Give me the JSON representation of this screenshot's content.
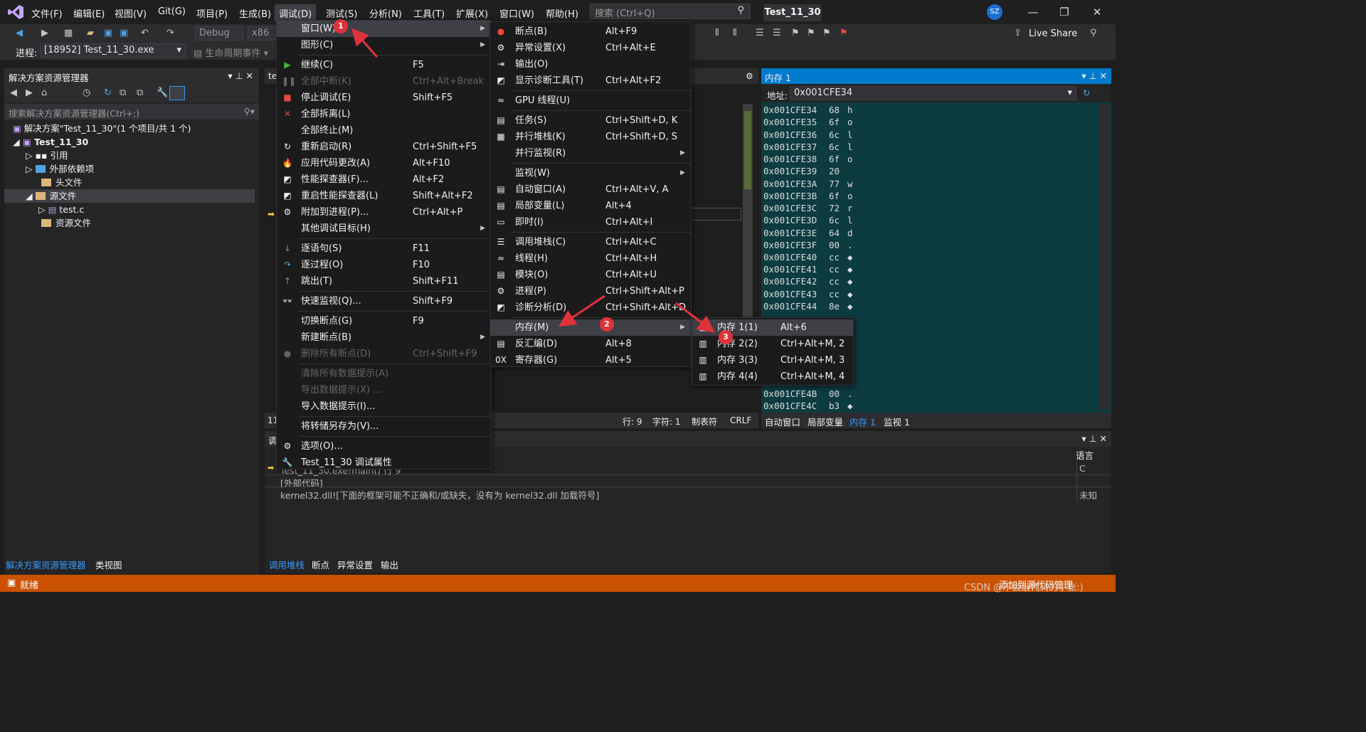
{
  "titlebar": {
    "menus": [
      "文件(F)",
      "编辑(E)",
      "视图(V)",
      "Git(G)",
      "项目(P)",
      "生成(B)",
      "调试(D)",
      "测试(S)",
      "分析(N)",
      "工具(T)",
      "扩展(X)",
      "窗口(W)",
      "帮助(H)"
    ],
    "search_placeholder": "搜索 (Ctrl+Q)",
    "solution_name": "Test_11_30",
    "avatar": "SZ"
  },
  "toolbar": {
    "config": "Debug",
    "platform": "x86",
    "process_label": "进程:",
    "process_value": "[18952] Test_11_30.exe",
    "lifecycle": "生命周期事件",
    "live_share": "Live Share"
  },
  "solution_explorer": {
    "title": "解决方案资源管理器",
    "search_placeholder": "搜索解决方案资源管理器(Ctrl+;)",
    "items": [
      {
        "label": "解决方案\"Test_11_30\"(1 个项目/共 1 个)"
      },
      {
        "label": "Test_11_30"
      },
      {
        "label": "引用"
      },
      {
        "label": "外部依赖项"
      },
      {
        "label": "头文件"
      },
      {
        "label": "源文件"
      },
      {
        "label": "test.c"
      },
      {
        "label": "资源文件"
      }
    ],
    "tabs": [
      "解决方案资源管理器",
      "类视图"
    ]
  },
  "editor": {
    "tab_fragment": "te",
    "zoom_fragment": "11",
    "status": {
      "line": "行: 9",
      "char": "字符: 1",
      "tabs": "制表符",
      "eol": "CRLF"
    }
  },
  "memory": {
    "title": "内存 1",
    "address_label": "地址:",
    "address": "0x001CFE34",
    "rows": [
      {
        "addr": "0x001CFE34",
        "hex": "68",
        "ch": "h"
      },
      {
        "addr": "0x001CFE35",
        "hex": "6f",
        "ch": "o"
      },
      {
        "addr": "0x001CFE36",
        "hex": "6c",
        "ch": "l"
      },
      {
        "addr": "0x001CFE37",
        "hex": "6c",
        "ch": "l"
      },
      {
        "addr": "0x001CFE38",
        "hex": "6f",
        "ch": "o"
      },
      {
        "addr": "0x001CFE39",
        "hex": "20",
        "ch": ""
      },
      {
        "addr": "0x001CFE3A",
        "hex": "77",
        "ch": "w"
      },
      {
        "addr": "0x001CFE3B",
        "hex": "6f",
        "ch": "o"
      },
      {
        "addr": "0x001CFE3C",
        "hex": "72",
        "ch": "r"
      },
      {
        "addr": "0x001CFE3D",
        "hex": "6c",
        "ch": "l"
      },
      {
        "addr": "0x001CFE3E",
        "hex": "64",
        "ch": "d"
      },
      {
        "addr": "0x001CFE3F",
        "hex": "00",
        "ch": "."
      },
      {
        "addr": "0x001CFE40",
        "hex": "cc",
        "ch": "◆"
      },
      {
        "addr": "0x001CFE41",
        "hex": "cc",
        "ch": "◆"
      },
      {
        "addr": "0x001CFE42",
        "hex": "cc",
        "ch": "◆"
      },
      {
        "addr": "0x001CFE43",
        "hex": "cc",
        "ch": "◆"
      },
      {
        "addr": "0x001CFE44",
        "hex": "8e",
        "ch": "◆"
      },
      {
        "addr": "0x001CFE4B",
        "hex": "00",
        "ch": "."
      },
      {
        "addr": "0x001CFE4C",
        "hex": "b3",
        "ch": "◆"
      }
    ],
    "tabs": [
      "自动窗口",
      "局部变量",
      "内存 1",
      "监视 1"
    ]
  },
  "callstack": {
    "title_fragment": "调",
    "lang_header": "语言",
    "rows": [
      {
        "text": "Test_11_30.exe!main() 行 9",
        "lang": "C"
      },
      {
        "text": "[外部代码]",
        "lang": ""
      },
      {
        "text": "kernel32.dll![下面的框架可能不正确和/或缺失，没有为 kernel32.dll 加载符号]",
        "lang": "未知"
      }
    ],
    "tabs": [
      "调用堆栈",
      "断点",
      "异常设置",
      "输出"
    ]
  },
  "statusbar": {
    "ready": "就绪",
    "right": "添加到源代码管理"
  },
  "debug_menu": [
    {
      "icon": "",
      "label": "窗口(W)",
      "shortcut": "",
      "sub": true,
      "hl": true
    },
    {
      "icon": "",
      "label": "图形(C)",
      "shortcut": "",
      "sub": true
    },
    {
      "sep": true
    },
    {
      "icon": "▶",
      "label": "继续(C)",
      "shortcut": "F5",
      "color": "#3fbf3f"
    },
    {
      "icon": "❚❚",
      "label": "全部中断(K)",
      "shortcut": "Ctrl+Alt+Break",
      "dis": true
    },
    {
      "icon": "■",
      "label": "停止调试(E)",
      "shortcut": "Shift+F5",
      "color": "#e8483b"
    },
    {
      "icon": "✕",
      "label": "全部拆离(L)",
      "shortcut": "",
      "color": "#e8483b"
    },
    {
      "icon": "",
      "label": "全部终止(M)",
      "shortcut": ""
    },
    {
      "icon": "↻",
      "label": "重新启动(R)",
      "shortcut": "Ctrl+Shift+F5"
    },
    {
      "icon": "🔥",
      "label": "应用代码更改(A)",
      "shortcut": "Alt+F10",
      "color": "#e8483b"
    },
    {
      "icon": "◩",
      "label": "性能探查器(F)...",
      "shortcut": "Alt+F2"
    },
    {
      "icon": "◩",
      "label": "重启性能探查器(L)",
      "shortcut": "Shift+Alt+F2"
    },
    {
      "icon": "⚙",
      "label": "附加到进程(P)...",
      "shortcut": "Ctrl+Alt+P"
    },
    {
      "icon": "",
      "label": "其他调试目标(H)",
      "shortcut": "",
      "sub": true
    },
    {
      "sep": true
    },
    {
      "icon": "↓",
      "label": "逐语句(S)",
      "shortcut": "F11",
      "color": "#4fa3e0"
    },
    {
      "icon": "↷",
      "label": "逐过程(O)",
      "shortcut": "F10",
      "color": "#4fa3e0"
    },
    {
      "icon": "↑",
      "label": "跳出(T)",
      "shortcut": "Shift+F11",
      "color": "#4fa3e0"
    },
    {
      "sep": true
    },
    {
      "icon": "👓",
      "label": "快速监视(Q)...",
      "shortcut": "Shift+F9"
    },
    {
      "sep": true
    },
    {
      "icon": "",
      "label": "切换断点(G)",
      "shortcut": "F9"
    },
    {
      "icon": "",
      "label": "新建断点(B)",
      "shortcut": "",
      "sub": true
    },
    {
      "icon": "●",
      "label": "删除所有断点(D)",
      "shortcut": "Ctrl+Shift+F9",
      "dis": true
    },
    {
      "sep": true
    },
    {
      "icon": "",
      "label": "清除所有数据提示(A)",
      "shortcut": "",
      "dis": true
    },
    {
      "icon": "",
      "label": "导出数据提示(X) ...",
      "shortcut": "",
      "dis": true
    },
    {
      "icon": "",
      "label": "导入数据提示(I)...",
      "shortcut": ""
    },
    {
      "sep": true
    },
    {
      "icon": "",
      "label": "将转储另存为(V)...",
      "shortcut": ""
    },
    {
      "sep": true
    },
    {
      "icon": "⚙",
      "label": "选项(O)...",
      "shortcut": ""
    },
    {
      "icon": "🔧",
      "label": "Test_11_30 调试属性",
      "shortcut": ""
    }
  ],
  "window_menu": [
    {
      "icon": "●",
      "label": "断点(B)",
      "shortcut": "Alt+F9",
      "color": "#e8483b"
    },
    {
      "icon": "⚙",
      "label": "异常设置(X)",
      "shortcut": "Ctrl+Alt+E"
    },
    {
      "icon": "⇥",
      "label": "输出(O)",
      "shortcut": ""
    },
    {
      "icon": "◩",
      "label": "显示诊断工具(T)",
      "shortcut": "Ctrl+Alt+F2"
    },
    {
      "sep": true
    },
    {
      "icon": "≈",
      "label": "GPU 线程(U)",
      "shortcut": ""
    },
    {
      "sep": true
    },
    {
      "icon": "▤",
      "label": "任务(S)",
      "shortcut": "Ctrl+Shift+D, K"
    },
    {
      "icon": "▦",
      "label": "并行堆栈(K)",
      "shortcut": "Ctrl+Shift+D, S"
    },
    {
      "icon": "",
      "label": "并行监视(R)",
      "shortcut": "",
      "sub": true
    },
    {
      "sep": true
    },
    {
      "icon": "",
      "label": "监视(W)",
      "shortcut": "",
      "sub": true
    },
    {
      "icon": "▤",
      "label": "自动窗口(A)",
      "shortcut": "Ctrl+Alt+V, A"
    },
    {
      "icon": "▤",
      "label": "局部变量(L)",
      "shortcut": "Alt+4"
    },
    {
      "icon": "▭",
      "label": "即时(I)",
      "shortcut": "Ctrl+Alt+I"
    },
    {
      "sep": true
    },
    {
      "icon": "☰",
      "label": "调用堆栈(C)",
      "shortcut": "Ctrl+Alt+C"
    },
    {
      "icon": "≈",
      "label": "线程(H)",
      "shortcut": "Ctrl+Alt+H"
    },
    {
      "icon": "▤",
      "label": "模块(O)",
      "shortcut": "Ctrl+Alt+U"
    },
    {
      "icon": "⚙",
      "label": "进程(P)",
      "shortcut": "Ctrl+Shift+Alt+P"
    },
    {
      "icon": "◩",
      "label": "诊断分析(D)",
      "shortcut": "Ctrl+Shift+Alt+D"
    },
    {
      "sep": true
    },
    {
      "icon": "",
      "label": "内存(M)",
      "shortcut": "",
      "sub": true,
      "hl": true
    },
    {
      "icon": "▤",
      "label": "反汇编(D)",
      "shortcut": "Alt+8"
    },
    {
      "icon": "0X",
      "label": "寄存器(G)",
      "shortcut": "Alt+5"
    }
  ],
  "memory_menu": [
    {
      "icon": "▥",
      "label": "内存 1(1)",
      "shortcut": "Alt+6",
      "hl": true
    },
    {
      "icon": "▥",
      "label": "内存 2(2)",
      "shortcut": "Ctrl+Alt+M, 2"
    },
    {
      "icon": "▥",
      "label": "内存 3(3)",
      "shortcut": "Ctrl+Alt+M, 3"
    },
    {
      "icon": "▥",
      "label": "内存 4(4)",
      "shortcut": "Ctrl+Alt+M, 4"
    }
  ],
  "annotations": {
    "badges": [
      "1",
      "2",
      "3"
    ],
    "color": "#e0323a"
  },
  "watermark": "CSDN @不会敲代码的小张:)"
}
